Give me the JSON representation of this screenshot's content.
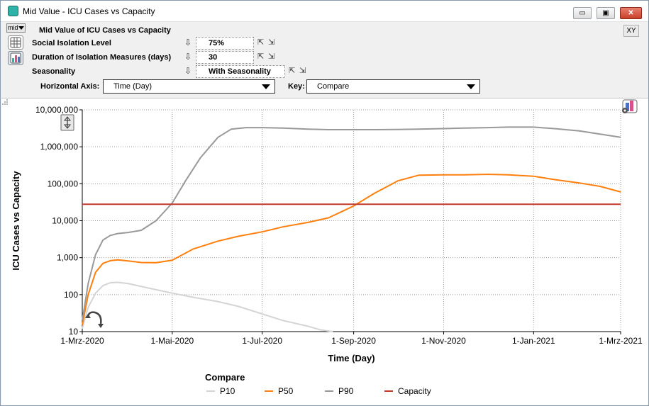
{
  "window": {
    "title": "Mid Value - ICU Cases vs Capacity",
    "minimize_glyph": "▭",
    "maximize_glyph": "▣",
    "close_glyph": "✕"
  },
  "toolbar": {
    "mid_select": "mid",
    "xy_button": "XY",
    "header_title": "Mid Value of ICU Cases vs Capacity"
  },
  "inputs": [
    {
      "label": "Social Isolation Level",
      "value": "75%"
    },
    {
      "label": "Duration of Isolation Measures   (days)",
      "value": "30"
    },
    {
      "label": "Seasonality",
      "value": "With Seasonality"
    }
  ],
  "axis_controls": {
    "horizontal_axis_label": "Horizontal Axis:",
    "horizontal_axis_value": "Time (Day)",
    "key_label": "Key:",
    "key_value": "Compare"
  },
  "icons": {
    "mid_select_arrow": "chevron-down-icon",
    "table_view": "table-grid-icon",
    "graph_view": "graph-view-icon",
    "spinner_arrow": "down-arrow-icon",
    "edit_definition": "edit-arrow-icon",
    "undo_definition": "undo-icon",
    "y_scale_toggle": "vertical-scale-icon",
    "rotate": "rotate-icon",
    "graph_settings": "graph-settings-icon",
    "resize_grip": "resize-grip-icon"
  },
  "colors": {
    "p10": "#d4d4d4",
    "p50": "#ff7f0e",
    "p90": "#999999",
    "capacity": "#c0392b"
  },
  "chart_data": {
    "type": "line",
    "title": "",
    "xlabel": "Time (Day)",
    "ylabel": "ICU Cases vs Capacity",
    "y_scale": "log",
    "ylim": [
      10,
      10000000
    ],
    "xlim": [
      "2020-03-01",
      "2021-03-01"
    ],
    "grid": true,
    "legend_position": "bottom",
    "x_tick_labels": [
      "1-Mrz-2020",
      "1-Mai-2020",
      "1-Jul-2020",
      "1-Sep-2020",
      "1-Nov-2020",
      "1-Jan-2021",
      "1-Mrz-2021"
    ],
    "x_tick_dates": [
      "2020-03-01",
      "2020-05-01",
      "2020-07-01",
      "2020-09-01",
      "2020-11-01",
      "2021-01-01",
      "2021-03-01"
    ],
    "y_tick_labels": [
      "10",
      "100",
      "1,000",
      "10,000",
      "100,000",
      "1,000,000",
      "10,000,000"
    ],
    "y_tick_values": [
      10,
      100,
      1000,
      10000,
      100000,
      1000000,
      10000000
    ],
    "legend_title": "Compare",
    "series": [
      {
        "name": "P10",
        "x": [
          "2020-03-01",
          "2020-03-05",
          "2020-03-10",
          "2020-03-15",
          "2020-03-20",
          "2020-03-25",
          "2020-04-01",
          "2020-04-15",
          "2020-05-01",
          "2020-05-15",
          "2020-06-01",
          "2020-06-15",
          "2020-07-01",
          "2020-07-15",
          "2020-08-01",
          "2020-08-10",
          "2020-08-18"
        ],
        "y": [
          12,
          45,
          110,
          175,
          210,
          215,
          200,
          150,
          110,
          85,
          65,
          48,
          30,
          20,
          14,
          11,
          10
        ]
      },
      {
        "name": "P50",
        "x": [
          "2020-03-01",
          "2020-03-05",
          "2020-03-10",
          "2020-03-15",
          "2020-03-20",
          "2020-03-25",
          "2020-04-01",
          "2020-04-10",
          "2020-04-20",
          "2020-05-01",
          "2020-05-15",
          "2020-06-01",
          "2020-06-15",
          "2020-07-01",
          "2020-07-15",
          "2020-08-01",
          "2020-08-15",
          "2020-09-01",
          "2020-09-15",
          "2020-10-01",
          "2020-10-15",
          "2020-11-01",
          "2020-11-15",
          "2020-12-01",
          "2020-12-15",
          "2021-01-01",
          "2021-01-15",
          "2021-02-01",
          "2021-02-15",
          "2021-03-01"
        ],
        "y": [
          15,
          100,
          400,
          700,
          830,
          870,
          820,
          740,
          730,
          850,
          1700,
          2800,
          3800,
          5000,
          6800,
          9000,
          12000,
          25000,
          55000,
          120000,
          170000,
          175000,
          175000,
          180000,
          175000,
          160000,
          130000,
          105000,
          85000,
          60000
        ]
      },
      {
        "name": "P90",
        "x": [
          "2020-03-01",
          "2020-03-05",
          "2020-03-10",
          "2020-03-15",
          "2020-03-20",
          "2020-03-25",
          "2020-04-01",
          "2020-04-10",
          "2020-04-20",
          "2020-05-01",
          "2020-05-10",
          "2020-05-20",
          "2020-06-01",
          "2020-06-10",
          "2020-06-20",
          "2020-07-01",
          "2020-07-15",
          "2020-08-01",
          "2020-08-15",
          "2020-09-01",
          "2020-09-15",
          "2020-10-01",
          "2020-10-15",
          "2020-11-01",
          "2020-11-15",
          "2020-12-01",
          "2020-12-15",
          "2021-01-01",
          "2021-01-15",
          "2021-02-01",
          "2021-02-15",
          "2021-03-01"
        ],
        "y": [
          20,
          200,
          1200,
          3000,
          4000,
          4500,
          4800,
          5500,
          10000,
          30000,
          120000,
          500000,
          1800000,
          3000000,
          3300000,
          3300000,
          3200000,
          3000000,
          2900000,
          2900000,
          2900000,
          2950000,
          3000000,
          3100000,
          3200000,
          3300000,
          3400000,
          3400000,
          3100000,
          2700000,
          2200000,
          1800000
        ]
      },
      {
        "name": "Capacity",
        "x": [
          "2020-03-01",
          "2021-03-01"
        ],
        "y": [
          28000,
          28000
        ]
      }
    ]
  }
}
